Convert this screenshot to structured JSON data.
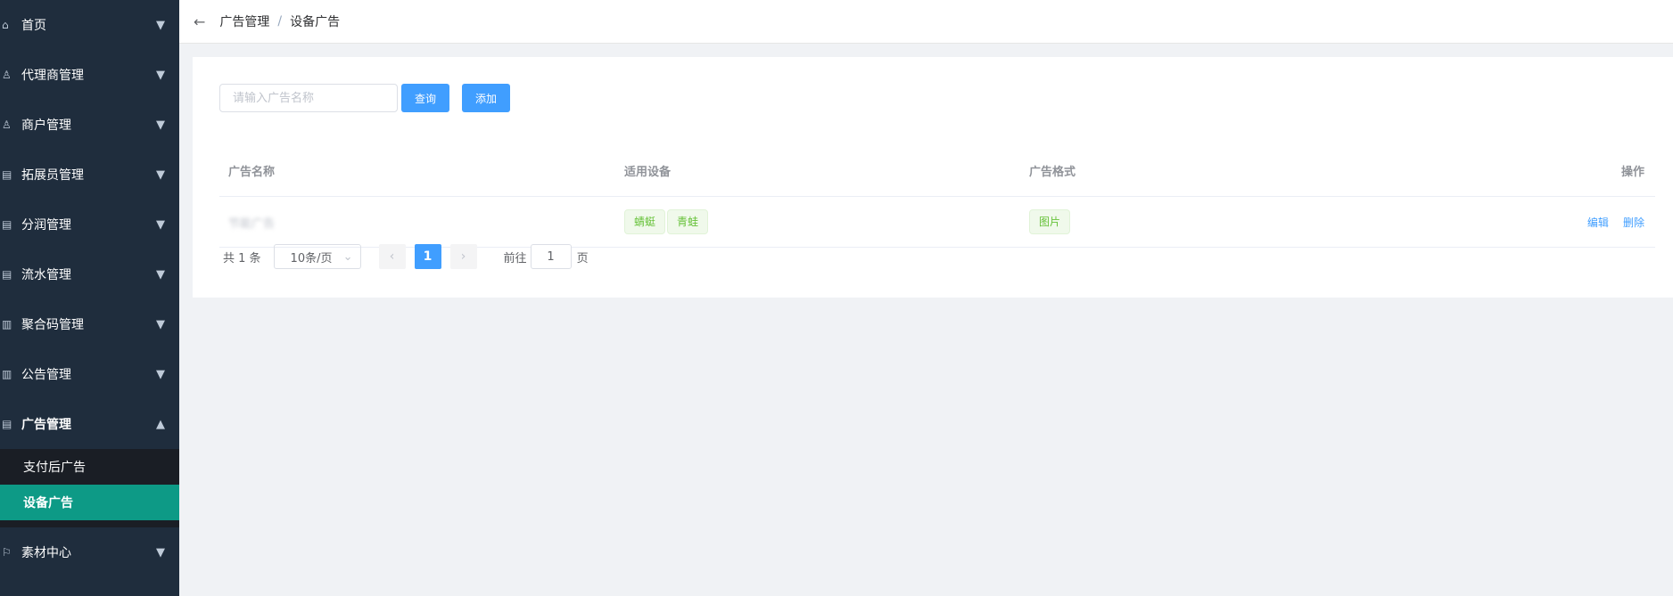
{
  "sidebar": {
    "items": [
      {
        "label": "首页",
        "icon": "home-icon",
        "glyph": "⌂",
        "arrow": "▼"
      },
      {
        "label": "代理商管理",
        "icon": "user-icon",
        "glyph": "♙",
        "arrow": "▼"
      },
      {
        "label": "商户管理",
        "icon": "user-icon",
        "glyph": "♙",
        "arrow": "▼"
      },
      {
        "label": "拓展员管理",
        "icon": "document-icon",
        "glyph": "▤",
        "arrow": "▼"
      },
      {
        "label": "分润管理",
        "icon": "document-icon",
        "glyph": "▤",
        "arrow": "▼"
      },
      {
        "label": "流水管理",
        "icon": "document-icon",
        "glyph": "▤",
        "arrow": "▼"
      },
      {
        "label": "聚合码管理",
        "icon": "notebook-icon",
        "glyph": "▥",
        "arrow": "▼"
      },
      {
        "label": "公告管理",
        "icon": "notebook-icon",
        "glyph": "▥",
        "arrow": "▼"
      },
      {
        "label": "广告管理",
        "icon": "document-icon",
        "glyph": "▤",
        "arrow": "▲"
      },
      {
        "label": "素材中心",
        "icon": "flag-icon",
        "glyph": "⚐",
        "arrow": "▼"
      }
    ],
    "submenu": [
      {
        "label": "支付后广告"
      },
      {
        "label": "设备广告"
      }
    ]
  },
  "topbar": {
    "back_glyph": "←",
    "breadcrumb": [
      "广告管理",
      "设备广告"
    ],
    "separator": "/"
  },
  "search": {
    "placeholder": "请输入广告名称",
    "value": "",
    "query_label": "查询",
    "add_label": "添加"
  },
  "table": {
    "headers": [
      "广告名称",
      "适用设备",
      "广告格式",
      "操作"
    ],
    "rows": [
      {
        "name": "节能广告",
        "devices": [
          "蜻蜓",
          "青蛙"
        ],
        "format": "图片",
        "actions": [
          "编辑",
          "删除"
        ]
      }
    ]
  },
  "pagination": {
    "total_text": "共 1 条",
    "page_size": "10条/页",
    "prev_glyph": "‹",
    "next_glyph": "›",
    "current": "1",
    "goto_prefix": "前往",
    "goto_value": "1",
    "goto_suffix": "页",
    "dropdown_glyph": "⌄"
  },
  "colors": {
    "sidebar_bg": "#1f2d3d",
    "active_item": "#0d9a86",
    "primary": "#409eff",
    "tag_green": "#67c23a"
  }
}
